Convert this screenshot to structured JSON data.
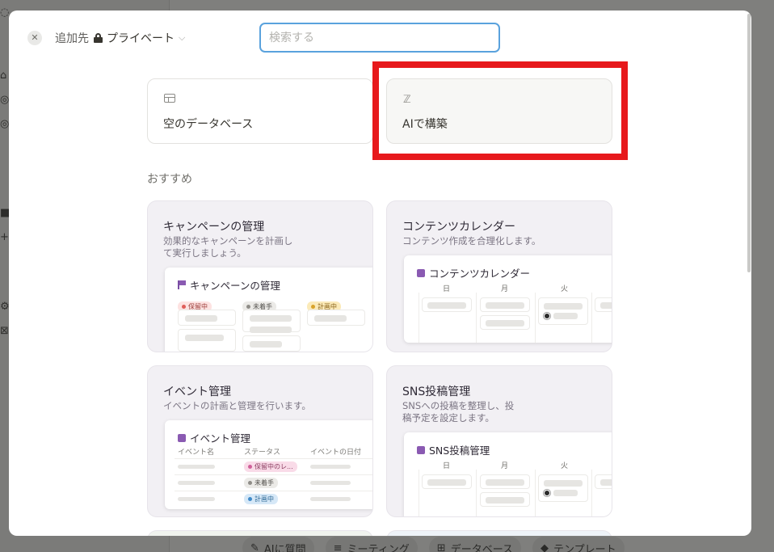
{
  "modal": {
    "close_icon": "close-icon",
    "add_to_label": "追加先",
    "privacy_label": "プライベート",
    "search_placeholder": "検索する"
  },
  "top_cards": {
    "empty_db": {
      "icon": "table-icon",
      "label": "空のデータベース"
    },
    "ai_build": {
      "icon": "ai-sparkle-icon",
      "label": "AIで構築"
    }
  },
  "highlight_color": "#e7191c",
  "section_title": "おすすめ",
  "templates": {
    "campaign": {
      "title": "キャンペーンの管理",
      "desc": "効果的なキャンペーンを計画して実行しましょう。",
      "preview_title": "キャンペーンの管理",
      "tags": [
        "保留中",
        "未着手",
        "計画中"
      ]
    },
    "content_calendar": {
      "title": "コンテンツカレンダー",
      "desc": "コンテンツ作成を合理化します。",
      "preview_title": "コンテンツカレンダー",
      "days": [
        "日",
        "月",
        "火"
      ]
    },
    "event": {
      "title": "イベント管理",
      "desc": "イベントの計画と管理を行います。",
      "preview_title": "イベント管理",
      "columns": [
        "イベント名",
        "ステータス",
        "イベントの日付"
      ],
      "statuses": [
        "保留中のレ...",
        "未着手",
        "計画中"
      ]
    },
    "sns": {
      "title": "SNS投稿管理",
      "desc": "SNSへの投稿を整理し、投稿予定を設定します。",
      "preview_title": "SNS投稿管理",
      "days": [
        "日",
        "月",
        "火"
      ]
    }
  },
  "background": {
    "bottom_bar": [
      "AIに質問",
      "ミーティング",
      "データベース",
      "テンプレート"
    ]
  }
}
